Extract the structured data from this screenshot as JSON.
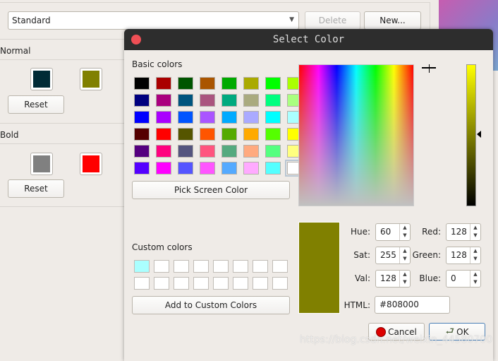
{
  "background": {
    "scheme_value": "Standard",
    "delete_label": "Delete",
    "new_label": "New...",
    "normal_label": "Normal",
    "bold_label": "Bold",
    "reset_label": "Reset",
    "normal_colors": [
      "#002b36",
      "#808000"
    ],
    "bold_colors": [
      "#808080",
      "#ff0000"
    ]
  },
  "dialog": {
    "title": "Select Color",
    "basic_colors_label": "Basic colors",
    "basic_colors": [
      [
        "#000000",
        "#aa0000",
        "#005500",
        "#aa5500",
        "#00aa00",
        "#aaaa00",
        "#00ff00",
        "#aaff00"
      ],
      [
        "#00007f",
        "#aa007f",
        "#00557f",
        "#aa557f",
        "#00aa7f",
        "#aaaa7f",
        "#00ff7f",
        "#aaff7f"
      ],
      [
        "#0000ff",
        "#aa00ff",
        "#0055ff",
        "#aa55ff",
        "#00aaff",
        "#aaaaff",
        "#00ffff",
        "#aaffff"
      ],
      [
        "#550000",
        "#ff0000",
        "#555500",
        "#ff5500",
        "#55aa00",
        "#ffaa00",
        "#55ff00",
        "#ffff00"
      ],
      [
        "#55007f",
        "#ff007f",
        "#55557f",
        "#ff557f",
        "#55aa7f",
        "#ffaa7f",
        "#55ff7f",
        "#ffff7f"
      ],
      [
        "#5500ff",
        "#ff00ff",
        "#5555ff",
        "#ff55ff",
        "#55aaff",
        "#ffaaff",
        "#55ffff",
        "#ffffff"
      ]
    ],
    "selected_basic": "#ffffff",
    "pick_screen_label": "Pick Screen Color",
    "custom_colors_label": "Custom colors",
    "custom_colors": [
      "#aaffff",
      "#ffffff",
      "#ffffff",
      "#ffffff",
      "#ffffff",
      "#ffffff",
      "#ffffff",
      "#ffffff",
      "#ffffff",
      "#ffffff",
      "#ffffff",
      "#ffffff",
      "#ffffff",
      "#ffffff",
      "#ffffff",
      "#ffffff"
    ],
    "add_custom_label": "Add to Custom Colors",
    "current_color": "#808000",
    "fields": {
      "hue_label": "Hue:",
      "hue": "60",
      "sat_label": "Sat:",
      "sat": "255",
      "val_label": "Val:",
      "val": "128",
      "red_label": "Red:",
      "red": "128",
      "green_label": "Green:",
      "green": "128",
      "blue_label": "Blue:",
      "blue": "0",
      "html_label": "HTML:",
      "html": "#808000"
    },
    "cancel_label": "Cancel",
    "ok_label": "OK"
  },
  "watermark": "https://blog.csdn.net/weixin_44580700"
}
